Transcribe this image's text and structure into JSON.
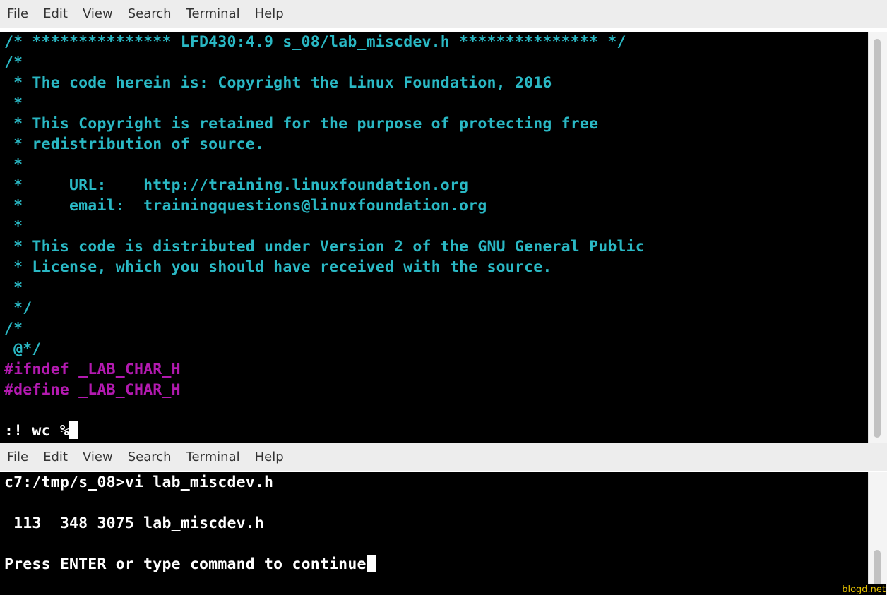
{
  "top_window": {
    "menu": [
      "File",
      "Edit",
      "View",
      "Search",
      "Terminal",
      "Help"
    ],
    "lines": [
      "/* *************** LFD430:4.9 s_08/lab_miscdev.h *************** */",
      "/*",
      " * The code herein is: Copyright the Linux Foundation, 2016",
      " *",
      " * This Copyright is retained for the purpose of protecting free",
      " * redistribution of source.",
      " *",
      " *     URL:    http://training.linuxfoundation.org",
      " *     email:  trainingquestions@linuxfoundation.org",
      " *",
      " * This code is distributed under Version 2 of the GNU General Public",
      " * License, which you should have received with the source.",
      " *",
      " */",
      "/*",
      " @*/",
      "#ifndef _LAB_CHAR_H",
      "#define _LAB_CHAR_H",
      "",
      ":! wc %"
    ]
  },
  "bottom_window": {
    "menu": [
      "File",
      "Edit",
      "View",
      "Search",
      "Terminal",
      "Help"
    ],
    "lines": [
      "c7:/tmp/s_08>vi lab_miscdev.h",
      "",
      " 113  348 3075 lab_miscdev.h",
      "",
      "Press ENTER or type command to continue"
    ]
  },
  "watermark": "blogd.net",
  "colors": {
    "comment": "#2ab8c4",
    "preprocessor": "#b31ab0",
    "text": "#ffffff",
    "terminal_bg": "#000000"
  }
}
